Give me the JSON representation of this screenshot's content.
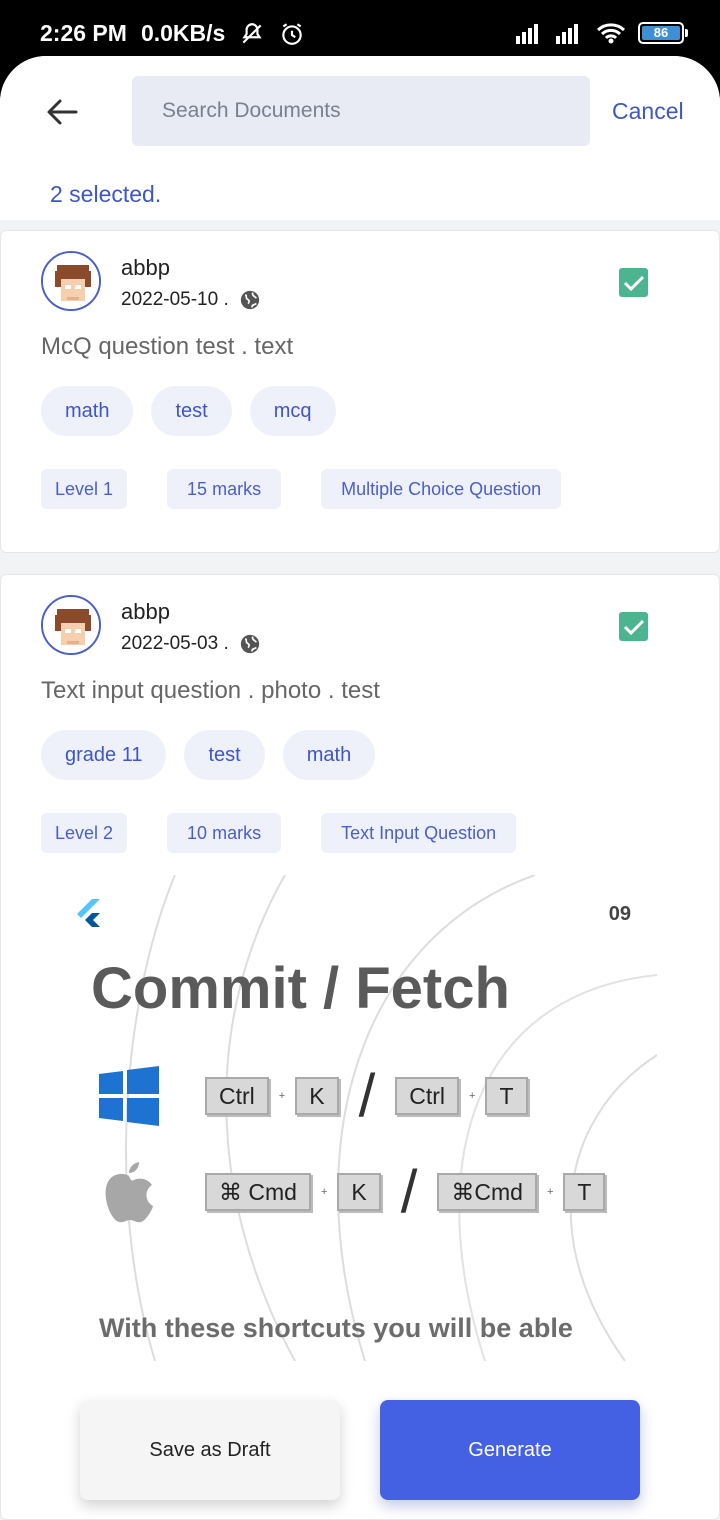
{
  "status_bar": {
    "time": "2:26 PM",
    "speed": "0.0KB/s",
    "battery": "86",
    "icons": [
      "mute-icon",
      "alarm-icon",
      "signal-icon",
      "signal-icon",
      "wifi-icon",
      "battery-icon"
    ]
  },
  "header": {
    "search_placeholder": "Search Documents",
    "cancel_label": "Cancel",
    "selected_text": "2 selected."
  },
  "documents": [
    {
      "author": "abbp",
      "date": "2022-05-10 .",
      "title": "McQ question test . text",
      "tags": [
        "math",
        "test",
        "mcq"
      ],
      "level": "Level 1",
      "marks": "15 marks",
      "type": "Multiple Choice Question",
      "selected": true
    },
    {
      "author": "abbp",
      "date": "2022-05-03 .",
      "title": "Text input question . photo . test",
      "tags": [
        "grade 11",
        "test",
        "math"
      ],
      "level": "Level 2",
      "marks": "10 marks",
      "type": "Text Input Question",
      "selected": true,
      "attachment": {
        "number": "09",
        "heading": "Commit / Fetch",
        "windows_keys": [
          "Ctrl",
          "K",
          "Ctrl",
          "T"
        ],
        "mac_keys": [
          "⌘ Cmd",
          "K",
          "⌘Cmd",
          "T"
        ],
        "caption": "With these shortcuts you will be able"
      }
    }
  ],
  "footer": {
    "draft_label": "Save as Draft",
    "generate_label": "Generate"
  },
  "colors": {
    "accent": "#3e56c8",
    "button_primary": "#4361e2",
    "checkbox": "#4cb58f",
    "tag_bg": "#eef1f9"
  }
}
